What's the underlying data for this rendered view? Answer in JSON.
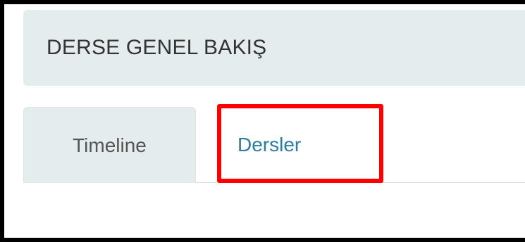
{
  "overview": {
    "title": "DERSE GENEL BAKIŞ"
  },
  "tabs": [
    {
      "label": "Timeline"
    },
    {
      "label": "Dersler"
    }
  ],
  "colors": {
    "highlight": "#ff0000",
    "link": "#2a7da3",
    "panel_bg": "#e5eced"
  }
}
